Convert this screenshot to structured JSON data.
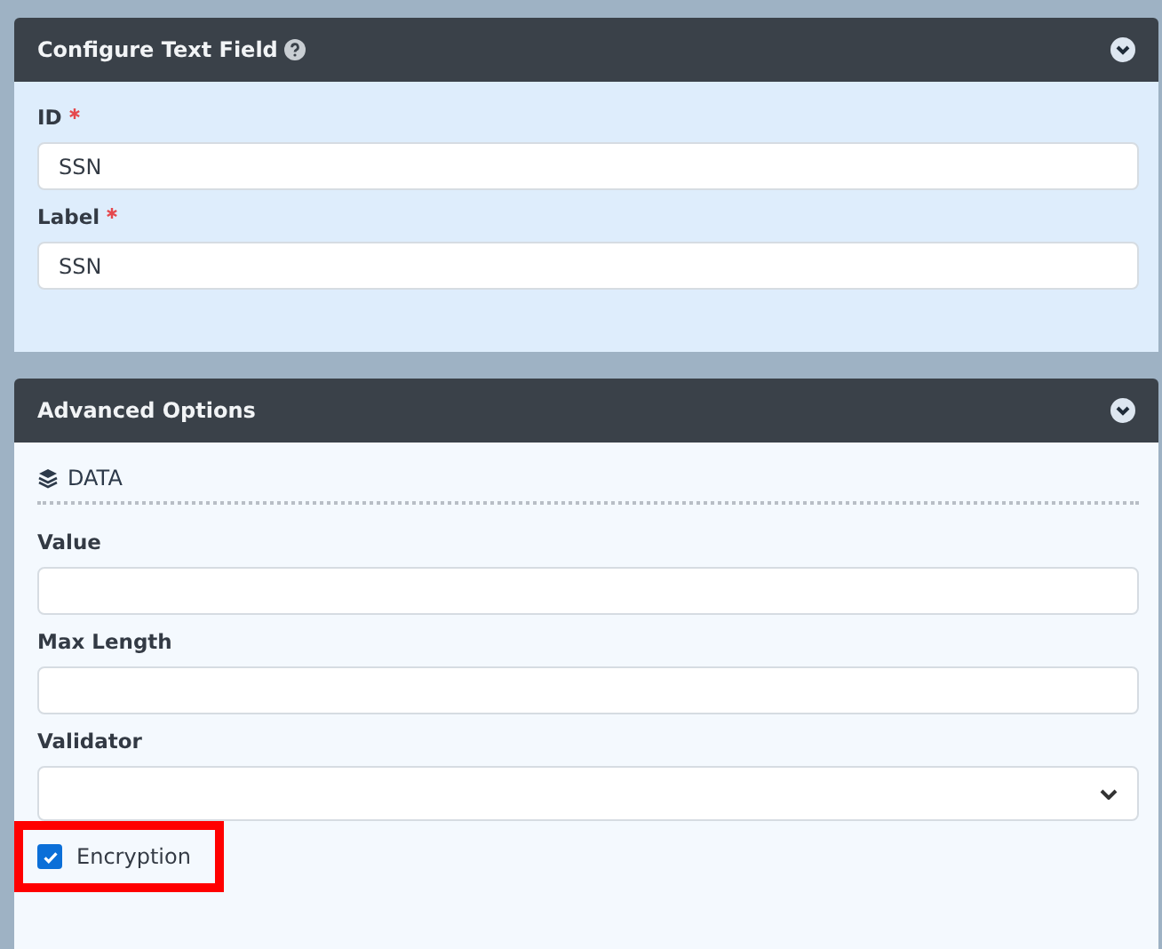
{
  "panels": [
    {
      "title": "Configure Text Field",
      "help_icon": true,
      "expanded": true,
      "fields": [
        {
          "kind": "text",
          "label": "ID",
          "required": true,
          "value": "SSN"
        },
        {
          "kind": "text",
          "label": "Label",
          "required": true,
          "value": "SSN"
        }
      ]
    },
    {
      "title": "Advanced Options",
      "help_icon": false,
      "expanded": true,
      "sections": [
        {
          "title": "DATA"
        }
      ],
      "fields": [
        {
          "kind": "text",
          "label": "Value",
          "required": false
        },
        {
          "kind": "text",
          "label": "Max Length",
          "required": false
        },
        {
          "kind": "select",
          "label": "Validator",
          "required": false
        },
        {
          "kind": "checkbox",
          "label": "Encryption",
          "checked": true,
          "highlighted": true
        }
      ]
    }
  ]
}
